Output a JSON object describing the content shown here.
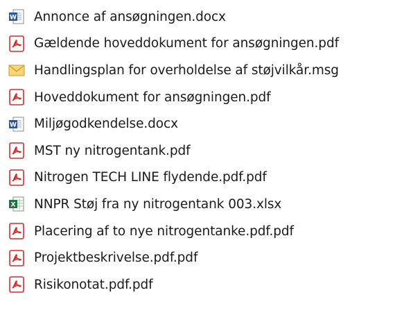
{
  "files": [
    {
      "name": "Annonce af ansøgningen.docx",
      "icon": "word-document-icon"
    },
    {
      "name": "Gældende hoveddokument for ansøgningen.pdf",
      "icon": "pdf-icon"
    },
    {
      "name": "Handlingsplan for overholdelse af støjvilkår.msg",
      "icon": "email-message-icon"
    },
    {
      "name": "Hoveddokument for ansøgningen.pdf",
      "icon": "pdf-icon"
    },
    {
      "name": "Miljøgodkendelse.docx",
      "icon": "word-document-icon"
    },
    {
      "name": "MST ny nitrogentank.pdf",
      "icon": "pdf-icon"
    },
    {
      "name": "Nitrogen TECH LINE flydende.pdf.pdf",
      "icon": "pdf-icon"
    },
    {
      "name": "NNPR Støj fra ny nitrogentank 003.xlsx",
      "icon": "excel-spreadsheet-icon"
    },
    {
      "name": "Placering af to nye nitrogentanke.pdf.pdf",
      "icon": "pdf-icon"
    },
    {
      "name": "Projektbeskrivelse.pdf.pdf",
      "icon": "pdf-icon"
    },
    {
      "name": "Risikonotat.pdf.pdf",
      "icon": "pdf-icon"
    }
  ],
  "colors": {
    "pdf_red": "#d62b2b",
    "word_blue": "#2b579a",
    "excel_green": "#217346",
    "mail_yellow": "#f2c24f"
  }
}
